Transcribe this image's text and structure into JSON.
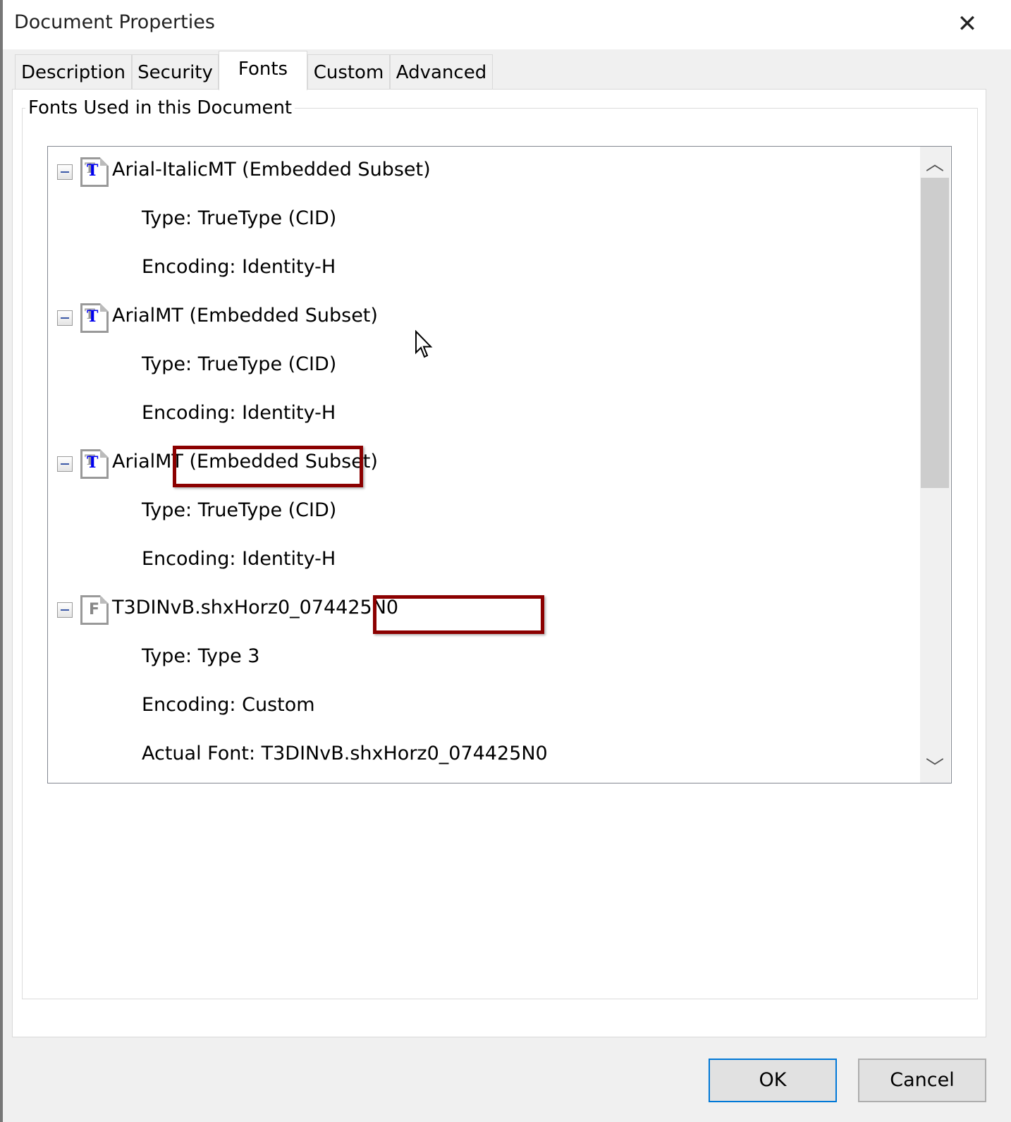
{
  "window": {
    "title": "Document Properties",
    "close_icon": "close-icon"
  },
  "tabs": [
    {
      "label": "Description"
    },
    {
      "label": "Security"
    },
    {
      "label": "Fonts",
      "active": true
    },
    {
      "label": "Custom"
    },
    {
      "label": "Advanced"
    }
  ],
  "group_label": "Fonts Used in this Document",
  "fonts": [
    {
      "name": "Arial-ItalicMT (Embedded Subset)",
      "icon": "truetype-font-icon",
      "details": [
        "Type: TrueType (CID)",
        "Encoding: Identity-H"
      ]
    },
    {
      "name": "ArialMT (Embedded Subset)",
      "icon": "truetype-font-icon",
      "details": [
        "Type: TrueType (CID)",
        "Encoding: Identity-H"
      ]
    },
    {
      "name": "ArialMT (Embedded Subset)",
      "icon": "truetype-font-icon",
      "details": [
        "Type: TrueType (CID)",
        "Encoding: Identity-H"
      ]
    },
    {
      "name": "T3DINvB.shxHorz0_074425N0",
      "icon": "type3-font-icon",
      "details": [
        "Type: Type 3",
        "Encoding: Custom",
        "Actual Font: T3DINvB.shxHorz0_074425N0"
      ]
    }
  ],
  "highlight_color": "#8b0000",
  "buttons": {
    "ok": "OK",
    "cancel": "Cancel"
  }
}
